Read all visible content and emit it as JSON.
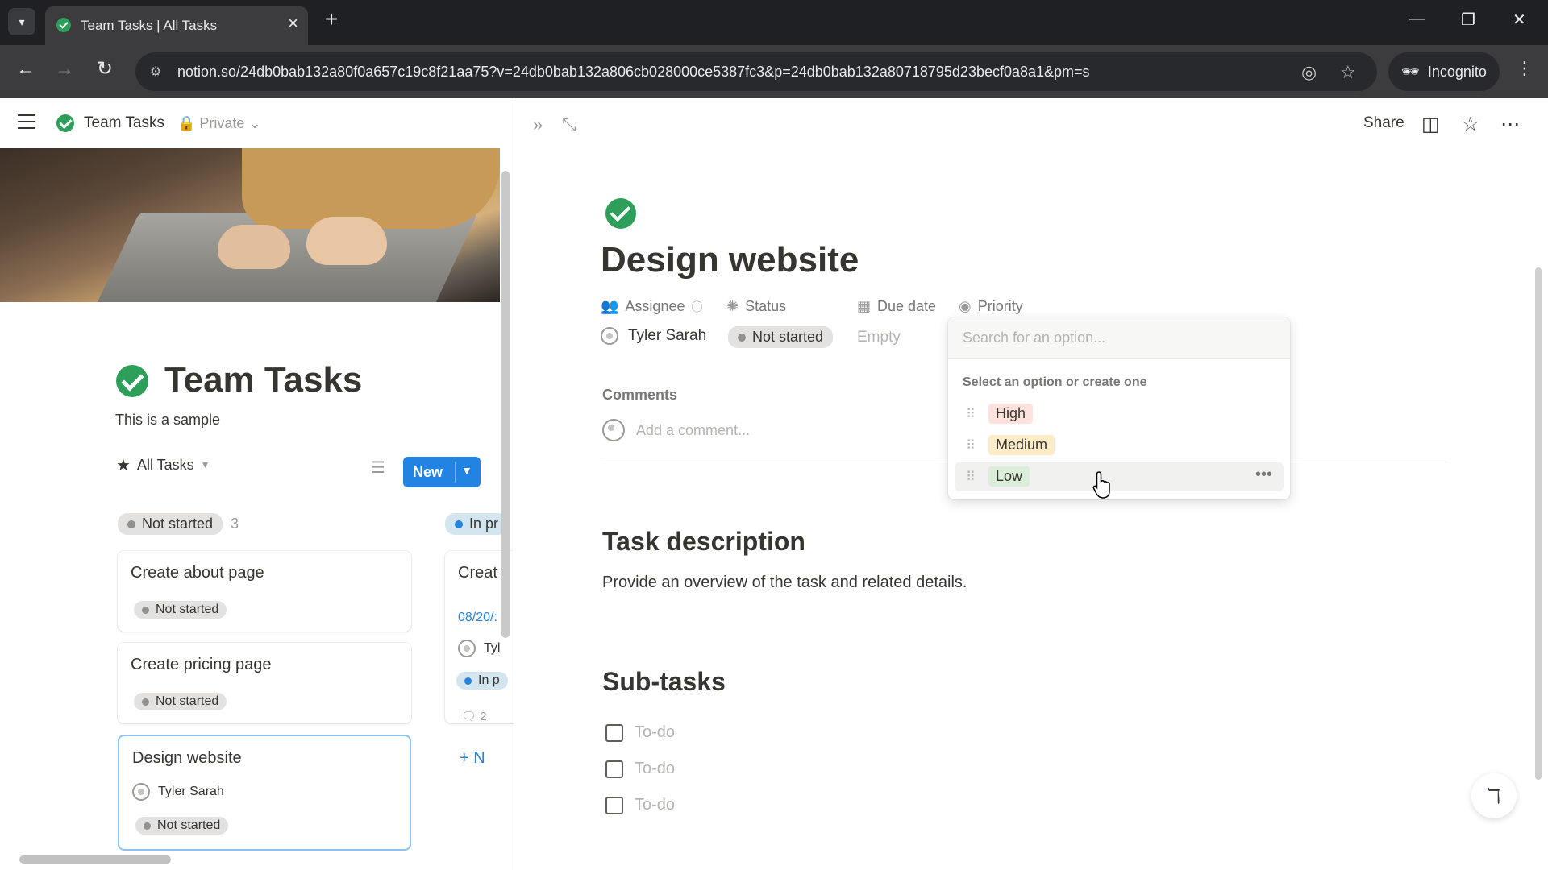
{
  "browser": {
    "tab_title": "Team Tasks | All Tasks",
    "url": "notion.so/24db0bab132a80f0a657c19c8f21aa75?v=24db0bab132a806cb028000ce5387fc3&p=24db0bab132a80718795d23becf0a8a1&pm=s",
    "profile_label": "Incognito"
  },
  "left": {
    "breadcrumb_title": "Team Tasks",
    "privacy": "Private",
    "db_title": "Team Tasks",
    "db_description": "This is a sample",
    "view_name": "All Tasks",
    "new_label": "New",
    "columns": [
      {
        "status": "Not started",
        "count": "3"
      },
      {
        "status": "In pr"
      }
    ],
    "cards": [
      {
        "title": "Create about page",
        "status": "Not started"
      },
      {
        "title": "Create pricing page",
        "status": "Not started"
      },
      {
        "title": "Design website",
        "assignee": "Tyler Sarah",
        "status": "Not started"
      }
    ],
    "col2_card": {
      "title": "Creat",
      "date": "08/20/:",
      "assignee": "Tyl",
      "status": "In p",
      "comments": "2"
    },
    "col2_add": "N"
  },
  "right": {
    "share": "Share",
    "title": "Design website",
    "props": {
      "assignee": "Assignee",
      "status": "Status",
      "due_date": "Due date",
      "priority": "Priority"
    },
    "values": {
      "assignee": "Tyler Sarah",
      "status": "Not started",
      "due_date": "Empty"
    },
    "comments_label": "Comments",
    "comment_placeholder": "Add a comment...",
    "task_heading": "Task description",
    "task_body": "Provide an overview of the task and related details.",
    "subtasks_heading": "Sub-tasks",
    "todos": [
      "To-do",
      "To-do",
      "To-do"
    ]
  },
  "dropdown": {
    "search_placeholder": "Search for an option...",
    "hint": "Select an option or create one",
    "options": [
      {
        "label": "High",
        "color": "#ffe2dd"
      },
      {
        "label": "Medium",
        "color": "#fdecc8"
      },
      {
        "label": "Low",
        "color": "#dbeddb"
      }
    ]
  },
  "colors": {
    "accent": "#2383e2",
    "check_green": "#2e9e5b"
  }
}
